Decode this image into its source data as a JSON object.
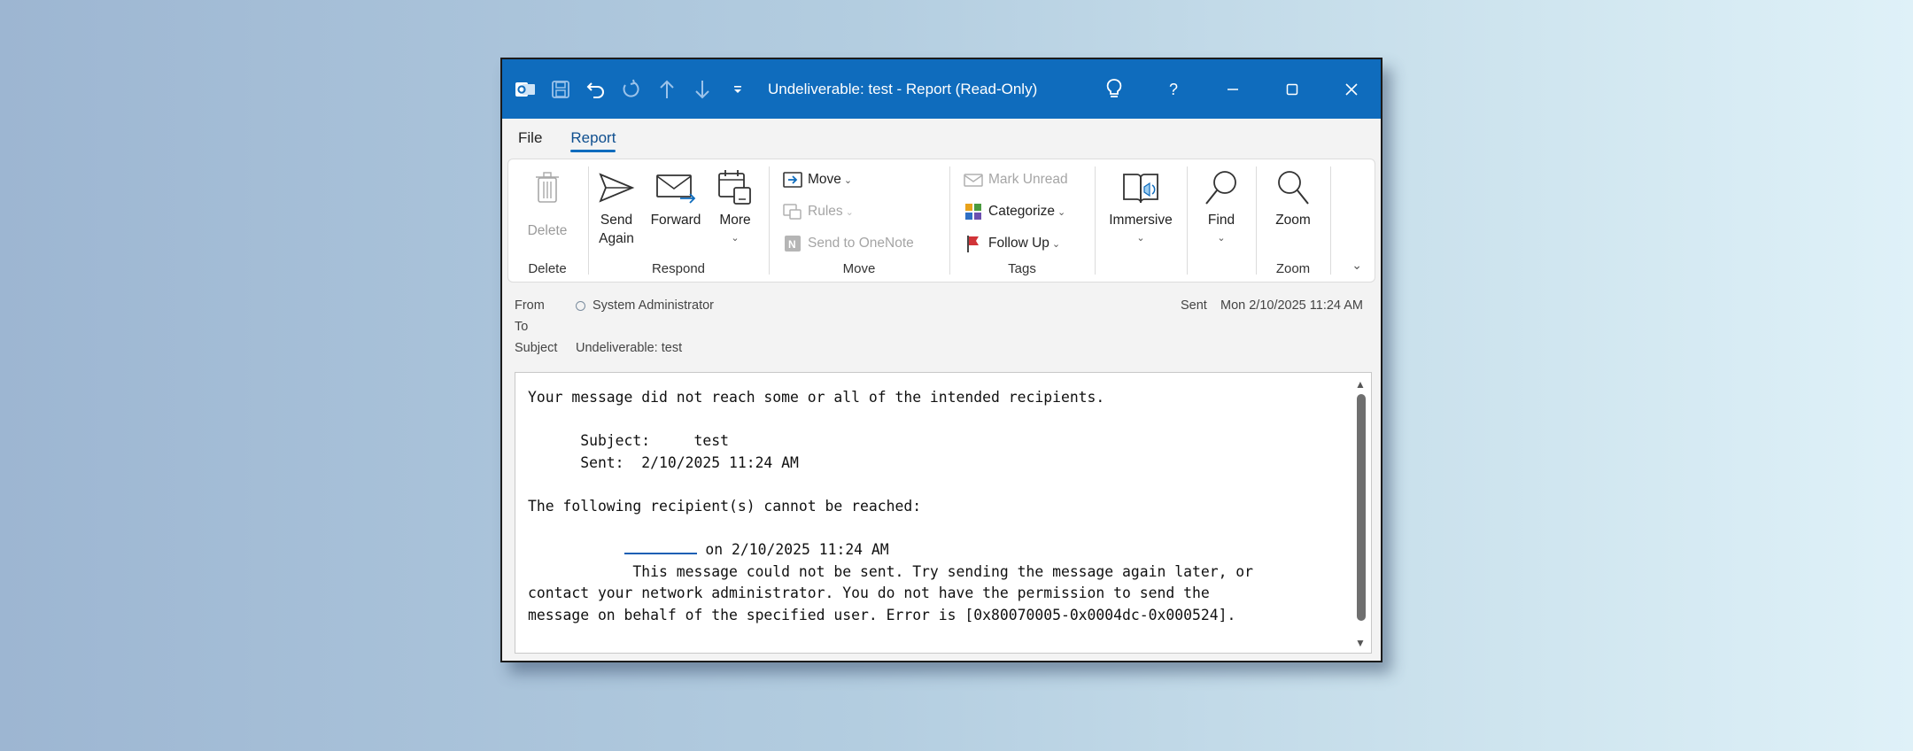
{
  "window": {
    "title": "Undeliverable: test  -  Report  (Read-Only)",
    "accent_color": "#0f6cbd",
    "icons": [
      "outlook-app-icon",
      "save-icon",
      "undo-icon",
      "redo-icon",
      "up-icon",
      "down-icon",
      "customize-icon",
      "lightbulb-icon",
      "help-icon",
      "minimize-icon",
      "maximize-icon",
      "close-icon"
    ]
  },
  "menu": {
    "tabs": [
      "File",
      "Report"
    ],
    "active": "Report"
  },
  "ribbon": {
    "delete_group": {
      "label": "Delete",
      "delete": "Delete"
    },
    "respond_group": {
      "label": "Respond",
      "send_again_1": "Send",
      "send_again_2": "Again",
      "forward": "Forward",
      "more": "More"
    },
    "move_group": {
      "label": "Move",
      "move": "Move",
      "rules": "Rules",
      "onenote": "Send to OneNote"
    },
    "tags_group": {
      "label": "Tags",
      "mark_unread": "Mark Unread",
      "categorize": "Categorize",
      "follow_up": "Follow Up"
    },
    "immersive": "Immersive",
    "find": "Find",
    "zoom_group": {
      "label": "Zoom",
      "zoom": "Zoom"
    }
  },
  "header": {
    "from_label": "From",
    "from_value": "System Administrator",
    "to_label": "To",
    "subject_label": "Subject",
    "subject_value": "Undeliverable: test",
    "sent_label": "Sent",
    "sent_value": "Mon 2/10/2025 11:24 AM"
  },
  "body": {
    "line1": "Your message did not reach some or all of the intended recipients.",
    "subject_line": "      Subject:     test",
    "sent_line": "      Sent:  2/10/2025 11:24 AM",
    "cannot_reach": "The following recipient(s) cannot be reached:",
    "recipient_date": " on 2/10/2025 11:24 AM",
    "error_1": "            This message could not be sent. Try sending the message again later, or",
    "error_2": "contact your network administrator. You do not have the permission to send the",
    "error_3": "message on behalf of the specified user. Error is [0x80070005-0x0004dc-0x000524]."
  }
}
